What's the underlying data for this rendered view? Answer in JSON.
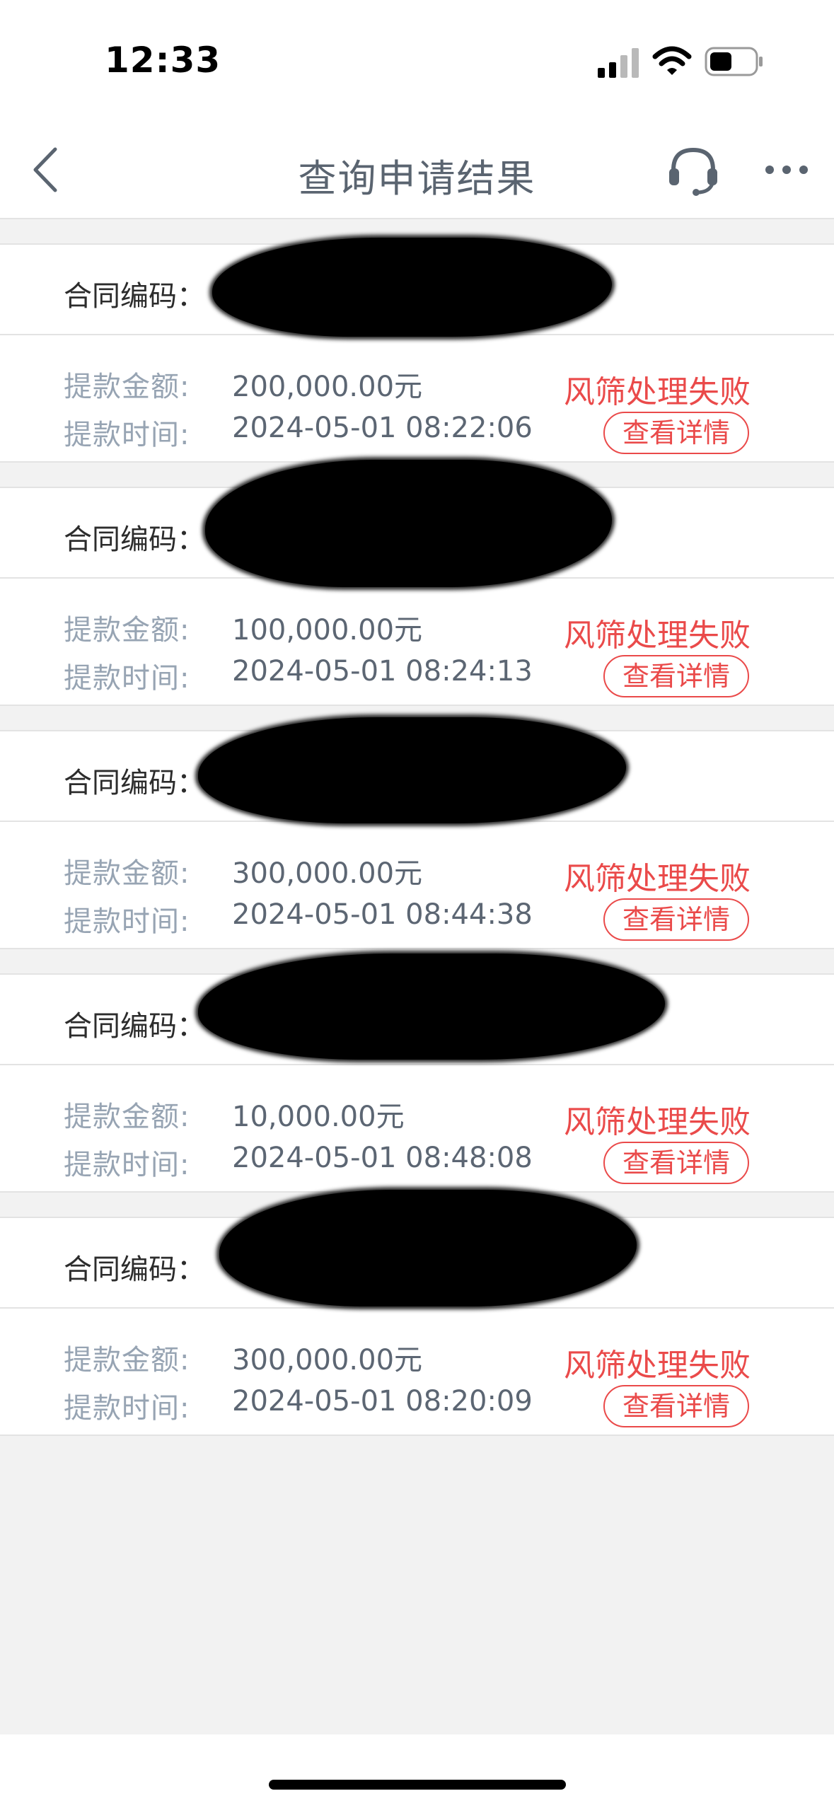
{
  "status_bar": {
    "time": "12:33"
  },
  "nav": {
    "title": "查询申请结果"
  },
  "labels": {
    "contract": "合同编码：",
    "amount": "提款金额:",
    "time": "提款时间:"
  },
  "records": [
    {
      "amount": "200,000.00元",
      "time": "2024-05-01 08:22:06",
      "status": "风筛处理失败",
      "details": "查看详情"
    },
    {
      "amount": "100,000.00元",
      "time": "2024-05-01 08:24:13",
      "status": "风筛处理失败",
      "details": "查看详情"
    },
    {
      "amount": "300,000.00元",
      "time": "2024-05-01 08:44:38",
      "status": "风筛处理失败",
      "details": "查看详情"
    },
    {
      "amount": "10,000.00元",
      "time": "2024-05-01 08:48:08",
      "status": "风筛处理失败",
      "details": "查看详情"
    },
    {
      "amount": "300,000.00元",
      "time": "2024-05-01 08:20:09",
      "status": "风筛处理失败",
      "details": "查看详情"
    }
  ],
  "colors": {
    "status_red": "#ea4a4a",
    "label_gray": "#97a4b3",
    "value_gray": "#5c6673",
    "background": "#f2f2f2"
  }
}
